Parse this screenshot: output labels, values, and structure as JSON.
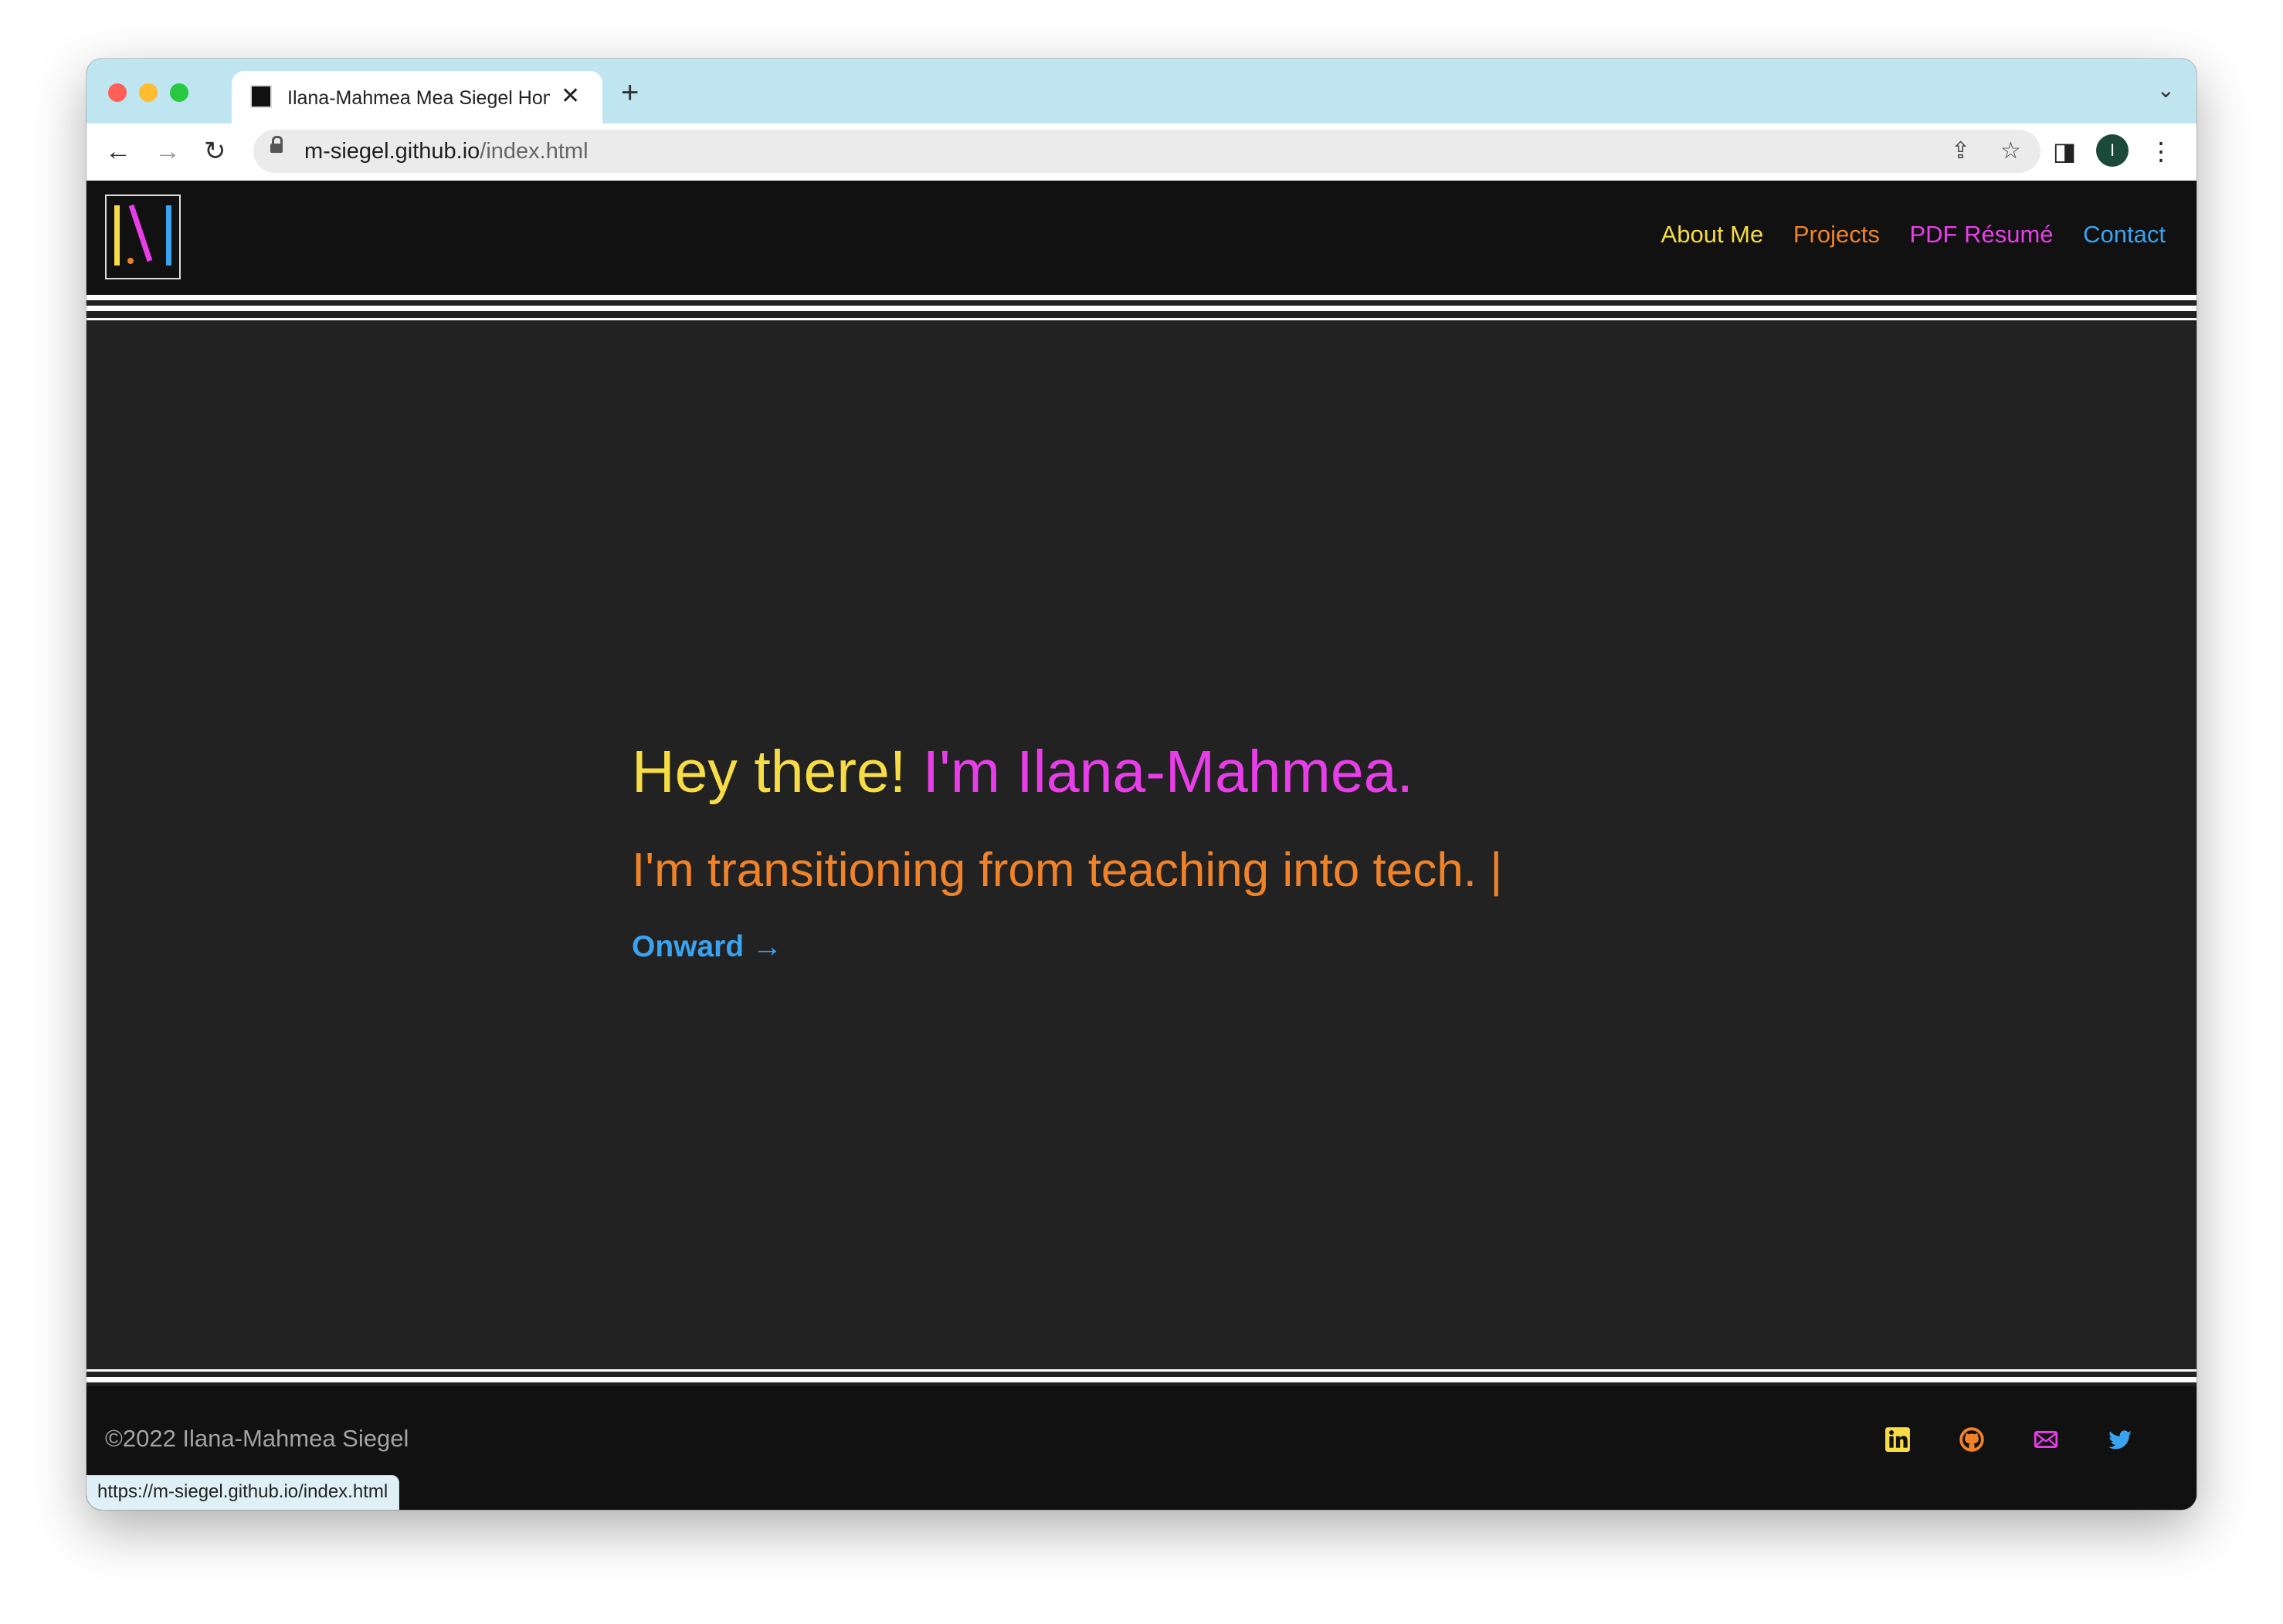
{
  "browser": {
    "tab_title": "Ilana-Mahmea Mea Siegel Home",
    "url_host": "m-siegel.github.io",
    "url_path": "/index.html",
    "avatar_initial": "I",
    "status_url": "https://m-siegel.github.io/index.html"
  },
  "nav": {
    "links": [
      {
        "label": "About Me",
        "color": "#f7dc45"
      },
      {
        "label": "Projects",
        "color": "#f0832a"
      },
      {
        "label": "PDF Résumé",
        "color": "#e83ee8"
      },
      {
        "label": "Contact",
        "color": "#3aa2ef"
      }
    ]
  },
  "hero": {
    "greeting": "Hey there!",
    "name": "I'm Ilana-Mahmea.",
    "tagline": "I'm transitioning from teaching into tech. |",
    "cta": "Onward →"
  },
  "footer": {
    "copyright": "©2022 Ilana-Mahmea Siegel",
    "social_icons": [
      "linkedin-icon",
      "github-icon",
      "mail-icon",
      "twitter-icon"
    ]
  },
  "colors": {
    "yellow": "#f7dc45",
    "orange": "#f0832a",
    "magenta": "#e83ee8",
    "blue": "#3aa2ef"
  }
}
